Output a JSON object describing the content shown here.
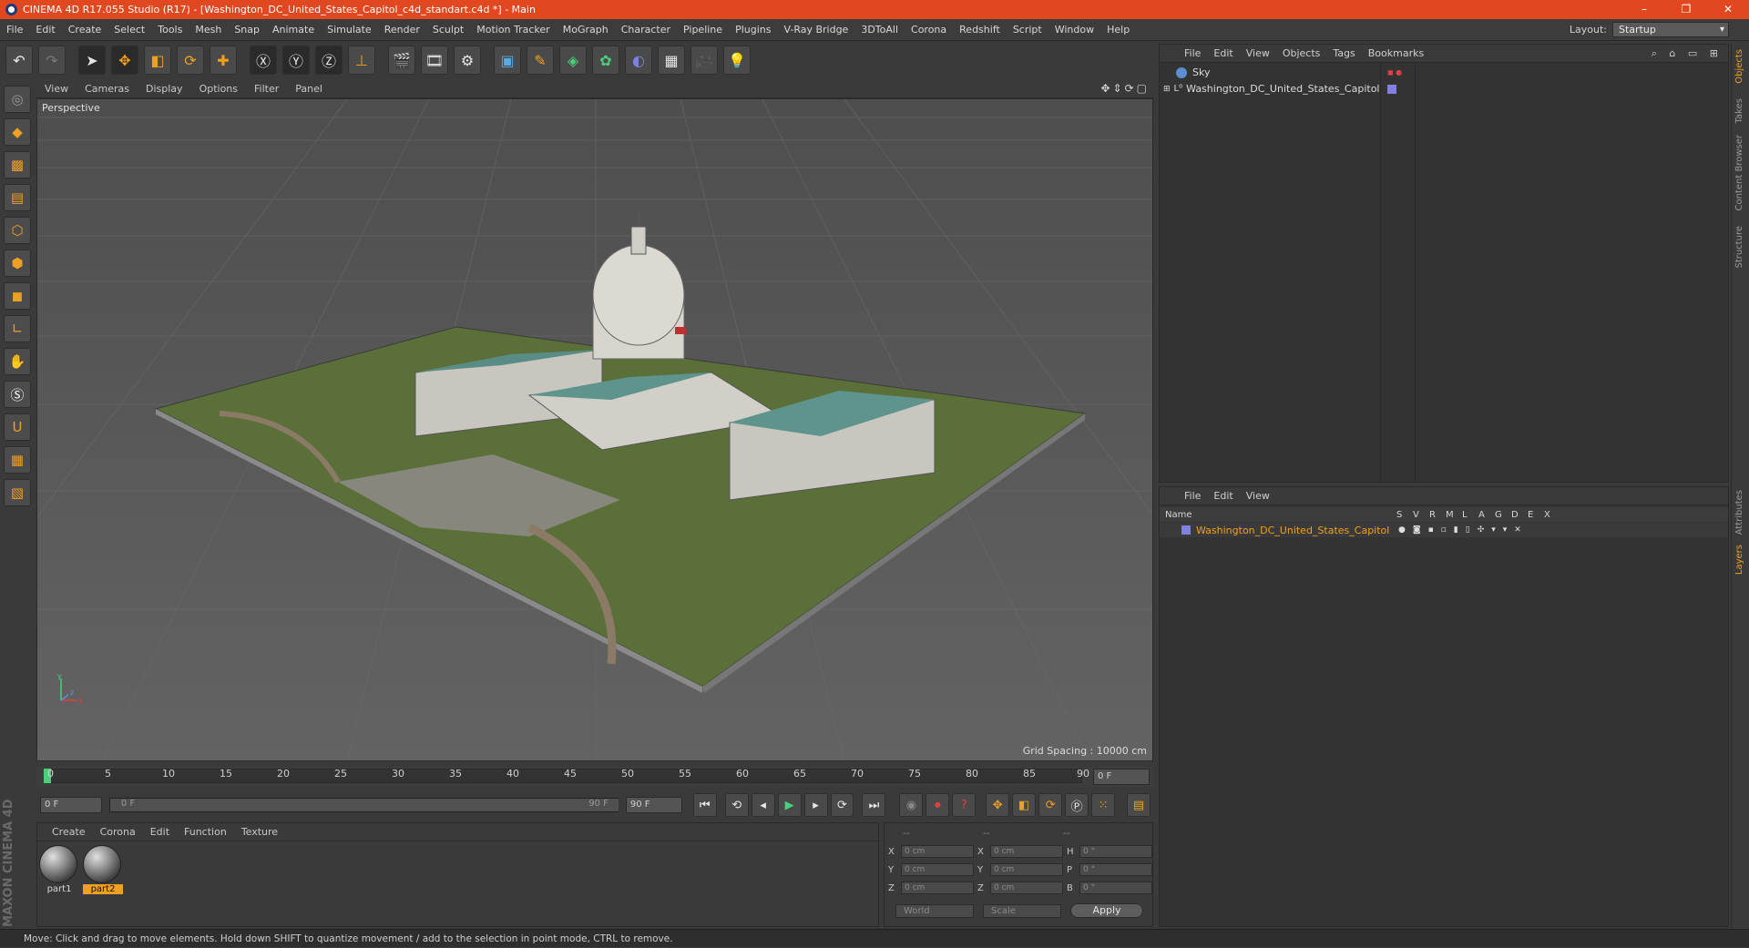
{
  "window": {
    "title": "CINEMA 4D R17.055 Studio (R17) - [Washington_DC_United_States_Capitol_c4d_standart.c4d *] - Main",
    "controls": [
      "–",
      "❐",
      "✕"
    ]
  },
  "menubar": [
    "File",
    "Edit",
    "Create",
    "Select",
    "Tools",
    "Mesh",
    "Snap",
    "Animate",
    "Simulate",
    "Render",
    "Sculpt",
    "Motion Tracker",
    "MoGraph",
    "Character",
    "Pipeline",
    "Plugins",
    "V-Ray Bridge",
    "3DToAll",
    "Corona",
    "Redshift",
    "Script",
    "Window",
    "Help"
  ],
  "layout": {
    "label": "Layout:",
    "value": "Startup"
  },
  "viewport": {
    "menu": [
      "View",
      "Cameras",
      "Display",
      "Options",
      "Filter",
      "Panel"
    ],
    "label": "Perspective",
    "grid_spacing": "Grid Spacing : 10000 cm",
    "axis_labels": [
      "y",
      "z",
      "x"
    ]
  },
  "timeline": {
    "ticks": [
      "0",
      "5",
      "10",
      "15",
      "20",
      "25",
      "30",
      "35",
      "40",
      "45",
      "50",
      "55",
      "60",
      "65",
      "70",
      "75",
      "80",
      "85",
      "90"
    ],
    "current_frame": "0 F",
    "start": "0 F",
    "range_start": "0 F",
    "range_end": "90 F",
    "end": "90 F"
  },
  "material_manager": {
    "menu": [
      "Create",
      "Corona",
      "Edit",
      "Function",
      "Texture"
    ],
    "materials": [
      {
        "name": "part1",
        "selected": false
      },
      {
        "name": "part2",
        "selected": true
      }
    ]
  },
  "coordinates": {
    "headers": [
      "--",
      "--",
      "--"
    ],
    "rows": [
      {
        "a": "X",
        "av": "0 cm",
        "b": "X",
        "bv": "0 cm",
        "c": "H",
        "cv": "0 °"
      },
      {
        "a": "Y",
        "av": "0 cm",
        "b": "Y",
        "bv": "0 cm",
        "c": "P",
        "cv": "0 °"
      },
      {
        "a": "Z",
        "av": "0 cm",
        "b": "Z",
        "bv": "0 cm",
        "c": "B",
        "cv": "0 °"
      }
    ],
    "mode": "World",
    "scale": "Scale",
    "apply": "Apply"
  },
  "object_manager": {
    "menu": [
      "File",
      "Edit",
      "View",
      "Objects",
      "Tags",
      "Bookmarks"
    ],
    "objects": [
      {
        "name": "Sky",
        "color": "#5a8fd0"
      },
      {
        "name": "Washington_DC_United_States_Capitol",
        "color": "#8080e0"
      }
    ]
  },
  "layer_manager": {
    "menu": [
      "File",
      "Edit",
      "View"
    ],
    "columns": [
      "Name",
      "S",
      "V",
      "R",
      "M",
      "L",
      "A",
      "G",
      "D",
      "E",
      "X"
    ],
    "layers": [
      {
        "name": "Washington_DC_United_States_Capitol",
        "color": "#8080e0"
      }
    ]
  },
  "side_tabs": [
    "Objects",
    "Takes",
    "Content Browser",
    "Structure",
    "Attributes",
    "Layers"
  ],
  "branding": "MAXON CINEMA 4D",
  "status": "Move: Click and drag to move elements. Hold down SHIFT to quantize movement / add to the selection in point mode, CTRL to remove.",
  "colors": {
    "titlebar": "#e2481f",
    "accent": "#f0a020",
    "layer": "#8080e0"
  }
}
